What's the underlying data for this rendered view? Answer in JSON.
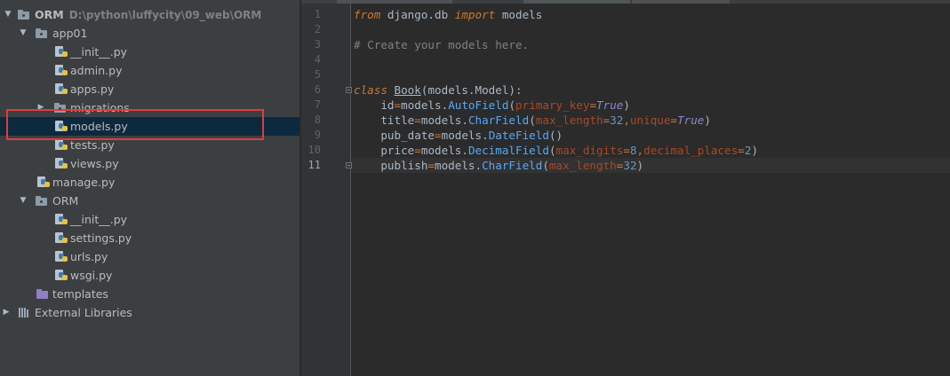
{
  "project_tree": {
    "root": {
      "name": "ORM",
      "path": "D:\\python\\luffycity\\09_web\\ORM"
    },
    "items": [
      {
        "label": "app01",
        "type": "folder"
      },
      {
        "label": "__init__.py",
        "type": "python-file"
      },
      {
        "label": "admin.py",
        "type": "python-file"
      },
      {
        "label": "apps.py",
        "type": "python-file"
      },
      {
        "label": "migrations",
        "type": "folder"
      },
      {
        "label": "models.py",
        "type": "python-file",
        "selected": true
      },
      {
        "label": "tests.py",
        "type": "python-file"
      },
      {
        "label": "views.py",
        "type": "python-file"
      },
      {
        "label": "manage.py",
        "type": "python-file"
      },
      {
        "label": "ORM",
        "type": "folder"
      },
      {
        "label": "__init__.py",
        "type": "python-file"
      },
      {
        "label": "settings.py",
        "type": "python-file"
      },
      {
        "label": "urls.py",
        "type": "python-file"
      },
      {
        "label": "wsgi.py",
        "type": "python-file"
      },
      {
        "label": "templates",
        "type": "template-folder"
      },
      {
        "label": "External Libraries",
        "type": "library"
      }
    ]
  },
  "editor": {
    "current_line": 11,
    "line_numbers": [
      "1",
      "2",
      "3",
      "4",
      "5",
      "6",
      "7",
      "8",
      "9",
      "10",
      "11"
    ],
    "code": {
      "l1": {
        "from": "from",
        "mod": " django.db ",
        "import": "import",
        "name": " models"
      },
      "l3": {
        "comment": "# Create your models here."
      },
      "l6": {
        "class_kw": "class",
        "sp": " ",
        "class_name": "Book",
        "base": "(models.Model):"
      },
      "l7": {
        "indent": "    ",
        "name": "id",
        "eq": "=",
        "obj": "models.",
        "fn": "AutoField",
        "open": "(",
        "p1": "primary_key",
        "eq1": "=",
        "v1": "True",
        "close": ")"
      },
      "l8": {
        "indent": "    ",
        "name": "title",
        "eq": "=",
        "obj": "models.",
        "fn": "CharField",
        "open": "(",
        "p1": "max_length",
        "eq1": "=",
        "v1": "32",
        "comma": ",",
        "p2": "unique",
        "eq2": "=",
        "v2": "True",
        "close": ")"
      },
      "l9": {
        "indent": "    ",
        "name": "pub_date",
        "eq": "=",
        "obj": "models.",
        "fn": "DateField",
        "call": "()"
      },
      "l10": {
        "indent": "    ",
        "name": "price",
        "eq": "=",
        "obj": "models.",
        "fn": "DecimalField",
        "open": "(",
        "p1": "max_digits",
        "eq1": "=",
        "v1": "8",
        "comma": ",",
        "p2": "decimal_places",
        "eq2": "=",
        "v2": "2",
        "close": ")"
      },
      "l11": {
        "indent": "    ",
        "name": "publish",
        "eq": "=",
        "obj": "models.",
        "fn": "CharField",
        "open": "(",
        "p1": "max_length",
        "eq1": "=",
        "v1": "32",
        "close": ")"
      }
    }
  },
  "colors": {
    "tree_bg": "#3c3f41",
    "editor_bg": "#2b2b2b",
    "selection_bg": "#0d293e",
    "annotation_box": "#e03c3c",
    "keyword": "#cc7832",
    "comment": "#808080",
    "number": "#6897bb",
    "parameter": "#aa4926",
    "builtin_true": "#8888c6"
  }
}
